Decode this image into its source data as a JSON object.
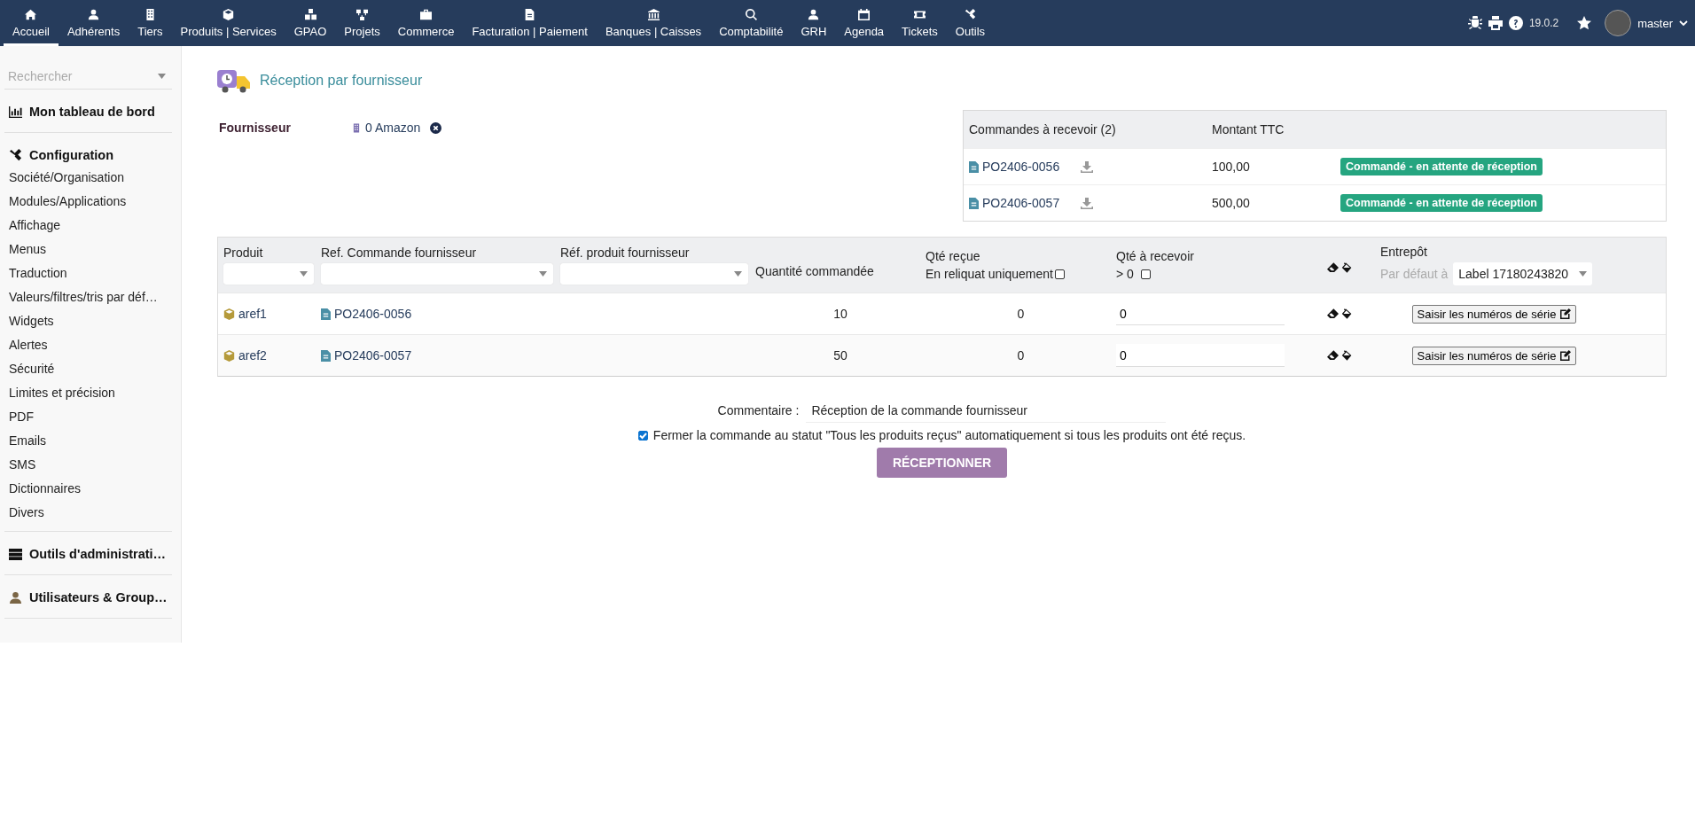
{
  "topbar": {
    "menu": [
      {
        "label": "Accueil",
        "selected": true
      },
      {
        "label": "Adhérents",
        "selected": false
      },
      {
        "label": "Tiers",
        "selected": false
      },
      {
        "label": "Produits | Services",
        "selected": false
      },
      {
        "label": "GPAO",
        "selected": false
      },
      {
        "label": "Projets",
        "selected": false
      },
      {
        "label": "Commerce",
        "selected": false
      },
      {
        "label": "Facturation | Paiement",
        "selected": false
      },
      {
        "label": "Banques | Caisses",
        "selected": false
      },
      {
        "label": "Comptabilité",
        "selected": false
      },
      {
        "label": "GRH",
        "selected": false
      },
      {
        "label": "Agenda",
        "selected": false
      },
      {
        "label": "Tickets",
        "selected": false
      },
      {
        "label": "Outils",
        "selected": false
      }
    ],
    "version": "19.0.2",
    "user": "master"
  },
  "sidebar": {
    "search": {
      "placeholder": "Rechercher"
    },
    "sections": [
      {
        "title": "Mon tableau de bord"
      },
      {
        "title": "Configuration",
        "items": [
          "Société/Organisation",
          "Modules/Applications",
          "Affichage",
          "Menus",
          "Traduction",
          "Valeurs/filtres/tris par déf…",
          "Widgets",
          "Alertes",
          "Sécurité",
          "Limites et précision",
          "PDF",
          "Emails",
          "SMS",
          "Dictionnaires",
          "Divers"
        ]
      },
      {
        "title": "Outils d'administrati…"
      },
      {
        "title": "Utilisateurs & Group…"
      }
    ]
  },
  "page": {
    "title": "Réception par fournisseur",
    "supplier_label": "Fournisseur",
    "supplier": "0 Amazon"
  },
  "orders": {
    "columns": [
      "Commandes à recevoir (2)",
      "Montant TTC"
    ],
    "rows": [
      {
        "ref": "PO2406-0056",
        "amount": "100,00",
        "status": "Commandé - en attente de réception"
      },
      {
        "ref": "PO2406-0057",
        "amount": "500,00",
        "status": "Commandé - en attente de réception"
      }
    ]
  },
  "lines": {
    "columns": [
      "Produit",
      "Ref. Commande fournisseur",
      "Réf. produit fournisseur",
      "Quantité commandée",
      "Qté reçue",
      "Qté à recevoir",
      "Entrepôt"
    ],
    "received_filter": {
      "label": "En reliquat uniquement",
      "checked": false
    },
    "to_receive_filter": {
      "label": "> 0",
      "checked": false
    },
    "warehouse_default_label": "Par défaut à",
    "warehouse": "Label 17180243820",
    "rows": [
      {
        "product": "aref1",
        "order_ref": "PO2406-0056",
        "ordered": "10",
        "received": "0",
        "to_receive": "0",
        "serial_button": "Saisir les numéros de série"
      },
      {
        "product": "aref2",
        "order_ref": "PO2406-0057",
        "ordered": "50",
        "received": "0",
        "to_receive": "0",
        "serial_button": "Saisir les numéros de série"
      }
    ]
  },
  "footer": {
    "comment_label": "Commentaire :",
    "comment": "Réception de la commande fournisseur",
    "close_order": {
      "label": "Fermer la commande au statut \"Tous les produits reçus\" automatiquement si tous les produits ont été reçus.",
      "checked": true
    },
    "submit": "RÉCEPTIONNER"
  }
}
